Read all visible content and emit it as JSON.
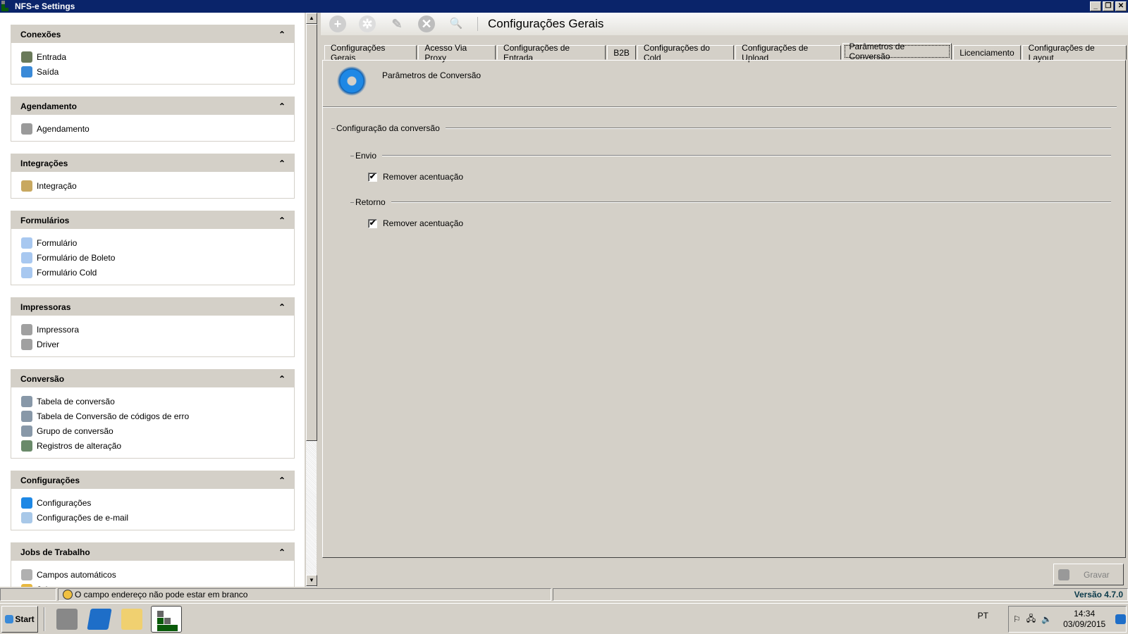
{
  "window": {
    "title": "NFS-e Settings",
    "min": "_",
    "max": "❐",
    "close": "✕"
  },
  "sidebar": {
    "panels": [
      {
        "title": "Conexões",
        "collapse": "⌃",
        "items": [
          {
            "label": "Entrada",
            "color": "#6a7a5a"
          },
          {
            "label": "Saída",
            "color": "#3a8ad8"
          }
        ]
      },
      {
        "title": "Agendamento",
        "collapse": "⌃",
        "items": [
          {
            "label": "Agendamento",
            "color": "#9a9a9a"
          }
        ]
      },
      {
        "title": "Integrações",
        "collapse": "⌃",
        "items": [
          {
            "label": "Integração",
            "color": "#c8a860"
          }
        ]
      },
      {
        "title": "Formulários",
        "collapse": "⌃",
        "items": [
          {
            "label": "Formulário",
            "color": "#a8c8f0"
          },
          {
            "label": "Formulário de Boleto",
            "color": "#a8c8f0"
          },
          {
            "label": "Formulário Cold",
            "color": "#a8c8f0"
          }
        ]
      },
      {
        "title": "Impressoras",
        "collapse": "⌃",
        "items": [
          {
            "label": "Impressora",
            "color": "#a0a0a0"
          },
          {
            "label": "Driver",
            "color": "#a0a0a0"
          }
        ]
      },
      {
        "title": "Conversão",
        "collapse": "⌃",
        "items": [
          {
            "label": "Tabela de conversão",
            "color": "#8898a8"
          },
          {
            "label": "Tabela de Conversão de códigos de erro",
            "color": "#8898a8"
          },
          {
            "label": "Grupo de conversão",
            "color": "#8898a8"
          },
          {
            "label": "Registros de alteração",
            "color": "#6a8a6a"
          }
        ]
      },
      {
        "title": "Configurações",
        "collapse": "⌃",
        "items": [
          {
            "label": "Configurações",
            "color": "#1e88e5"
          },
          {
            "label": "Configurações de e-mail",
            "color": "#a8c8e8"
          }
        ]
      },
      {
        "title": "Jobs de Trabalho",
        "collapse": "⌃",
        "items": [
          {
            "label": "Campos automáticos",
            "color": "#b0b0b0"
          },
          {
            "label": "Job",
            "color": "#e8b840"
          }
        ]
      }
    ]
  },
  "toolbar": {
    "title": "Configurações Gerais",
    "buttons": [
      "+",
      "✲",
      "✎",
      "✕",
      "🔍"
    ]
  },
  "tabs": [
    "Configurações Gerais",
    "Acesso Via Proxy",
    "Configurações de Entrada",
    "B2B",
    "Configurações do Cold",
    "Configurações de Upload",
    "Parâmetros de Conversão",
    "Licenciamento",
    "Configurações de Layout"
  ],
  "active_tab": 6,
  "content": {
    "title": "Parâmetros de Conversão",
    "group": "Configuração da conversão",
    "envio": {
      "label": "Envio",
      "checkbox": "Remover acentuação",
      "checked": true,
      "mark": "✔"
    },
    "retorno": {
      "label": "Retorno",
      "checkbox": "Remover acentuação",
      "checked": true,
      "mark": "✔"
    }
  },
  "save_button": "Gravar",
  "status": {
    "message": "O campo endereço não pode estar em branco",
    "version": "Versão 4.7.0"
  },
  "taskbar": {
    "start": "Start",
    "lang": "PT",
    "time": "14:34",
    "date": "03/09/2015"
  }
}
